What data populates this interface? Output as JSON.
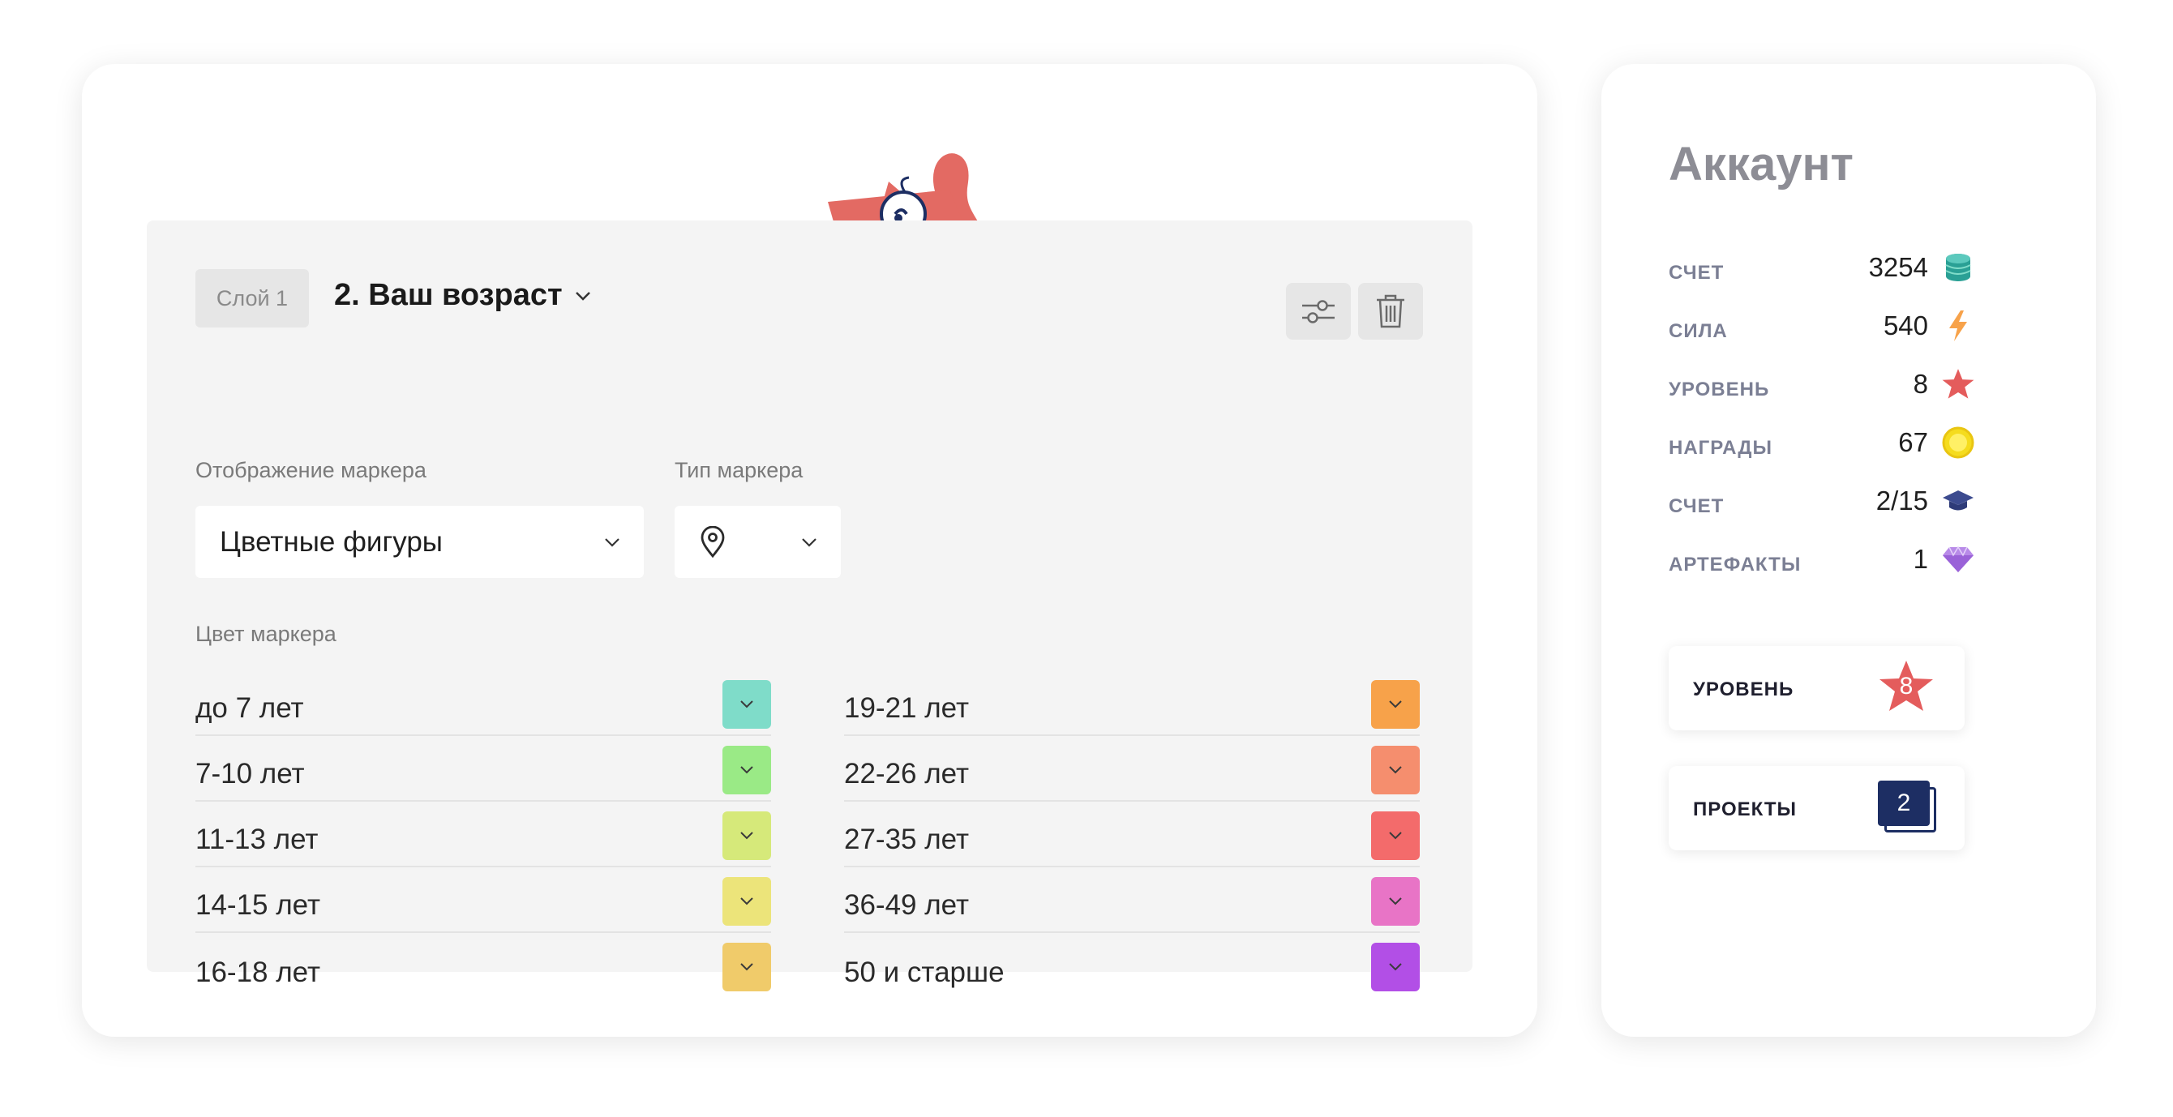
{
  "layer": {
    "chip_label": "Слой 1",
    "title": "2. Ваш возраст"
  },
  "fields": {
    "display_label": "Отображение маркера",
    "display_value": "Цветные фигуры",
    "type_label": "Тип маркера",
    "color_label": "Цвет маркера"
  },
  "age_groups_left": [
    {
      "label": "до 7 лет",
      "color": "#7fdcc9"
    },
    {
      "label": "7-10 лет",
      "color": "#9aea86"
    },
    {
      "label": "11-13 лет",
      "color": "#d6e97a"
    },
    {
      "label": "14-15 лет",
      "color": "#ece47a"
    },
    {
      "label": "16-18 лет",
      "color": "#f0cb6a"
    }
  ],
  "age_groups_right": [
    {
      "label": "19-21 лет",
      "color": "#f7a24a"
    },
    {
      "label": "22-26 лет",
      "color": "#f58e6e"
    },
    {
      "label": "27-35 лет",
      "color": "#f36b6b"
    },
    {
      "label": "36-49 лет",
      "color": "#e874c6"
    },
    {
      "label": "50 и старше",
      "color": "#b24fe6"
    }
  ],
  "account": {
    "title": "Аккаунт",
    "stats": [
      {
        "label": "СЧЕТ",
        "value": "3254",
        "icon": "coins-icon"
      },
      {
        "label": "СИЛА",
        "value": "540",
        "icon": "lightning-icon"
      },
      {
        "label": "УРОВЕНЬ",
        "value": "8",
        "icon": "star-icon"
      },
      {
        "label": "НАГРАДЫ",
        "value": "67",
        "icon": "coin-icon"
      },
      {
        "label": "СЧЕТ",
        "value": "2/15",
        "icon": "graduation-cap-icon"
      },
      {
        "label": "АРТЕФАКТЫ",
        "value": "1",
        "icon": "diamond-icon"
      }
    ],
    "level_badge": {
      "label": "УРОВЕНЬ",
      "value": "8"
    },
    "projects_badge": {
      "label": "ПРОЕКТЫ",
      "value": "2"
    }
  },
  "colors": {
    "accent_star": "#e45c5c",
    "projects_navy": "#1d2e63"
  }
}
